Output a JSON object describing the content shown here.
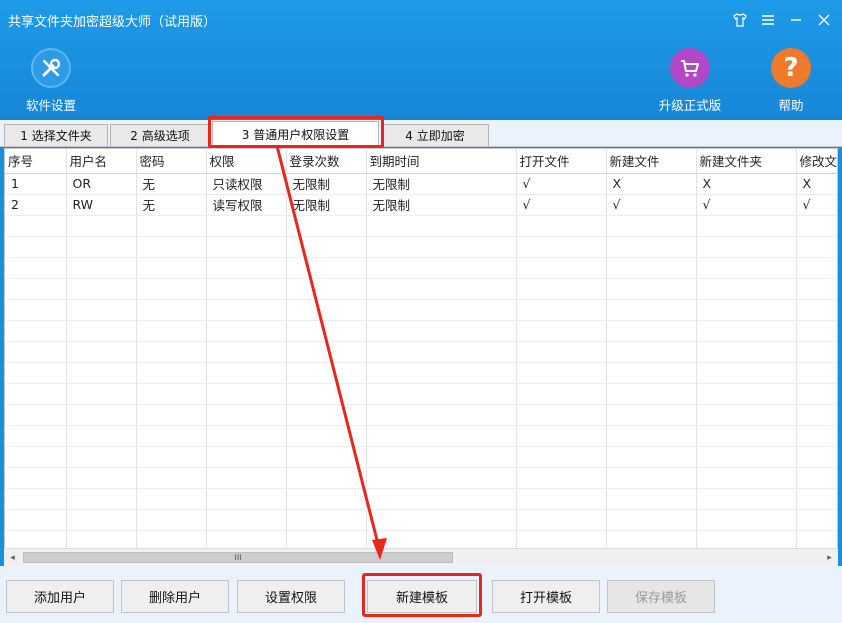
{
  "window": {
    "title": "共享文件夹加密超级大师（试用版）"
  },
  "toolbar": {
    "settings_label": "软件设置",
    "upgrade_label": "升级正式版",
    "help_label": "帮助",
    "help_glyph": "?"
  },
  "tabs": [
    {
      "label": "1 选择文件夹"
    },
    {
      "label": "2 高级选项"
    },
    {
      "label": "3 普通用户权限设置"
    },
    {
      "label": "4 立即加密"
    }
  ],
  "table": {
    "columns": [
      "序号",
      "用户名",
      "密码",
      "权限",
      "登录次数",
      "到期时间",
      "打开文件",
      "新建文件",
      "新建文件夹",
      "修改文件"
    ],
    "rows": [
      [
        "1",
        "OR",
        "无",
        "只读权限",
        "无限制",
        "无限制",
        "√",
        "X",
        "X",
        "X"
      ],
      [
        "2",
        "RW",
        "无",
        "读写权限",
        "无限制",
        "无限制",
        "√",
        "√",
        "√",
        "√"
      ]
    ]
  },
  "scrollbar": {
    "left_arrow": "◂",
    "right_arrow": "▸",
    "thumb_grip": "III"
  },
  "buttons": {
    "add_user": "添加用户",
    "delete_user": "删除用户",
    "set_permission": "设置权限",
    "new_template": "新建模板",
    "open_template": "打开模板",
    "save_template": "保存模板"
  },
  "colors": {
    "accent": "#1e9be8",
    "highlight": "#e8271c",
    "upgrade": "#b148c8",
    "help": "#f07a2c"
  }
}
